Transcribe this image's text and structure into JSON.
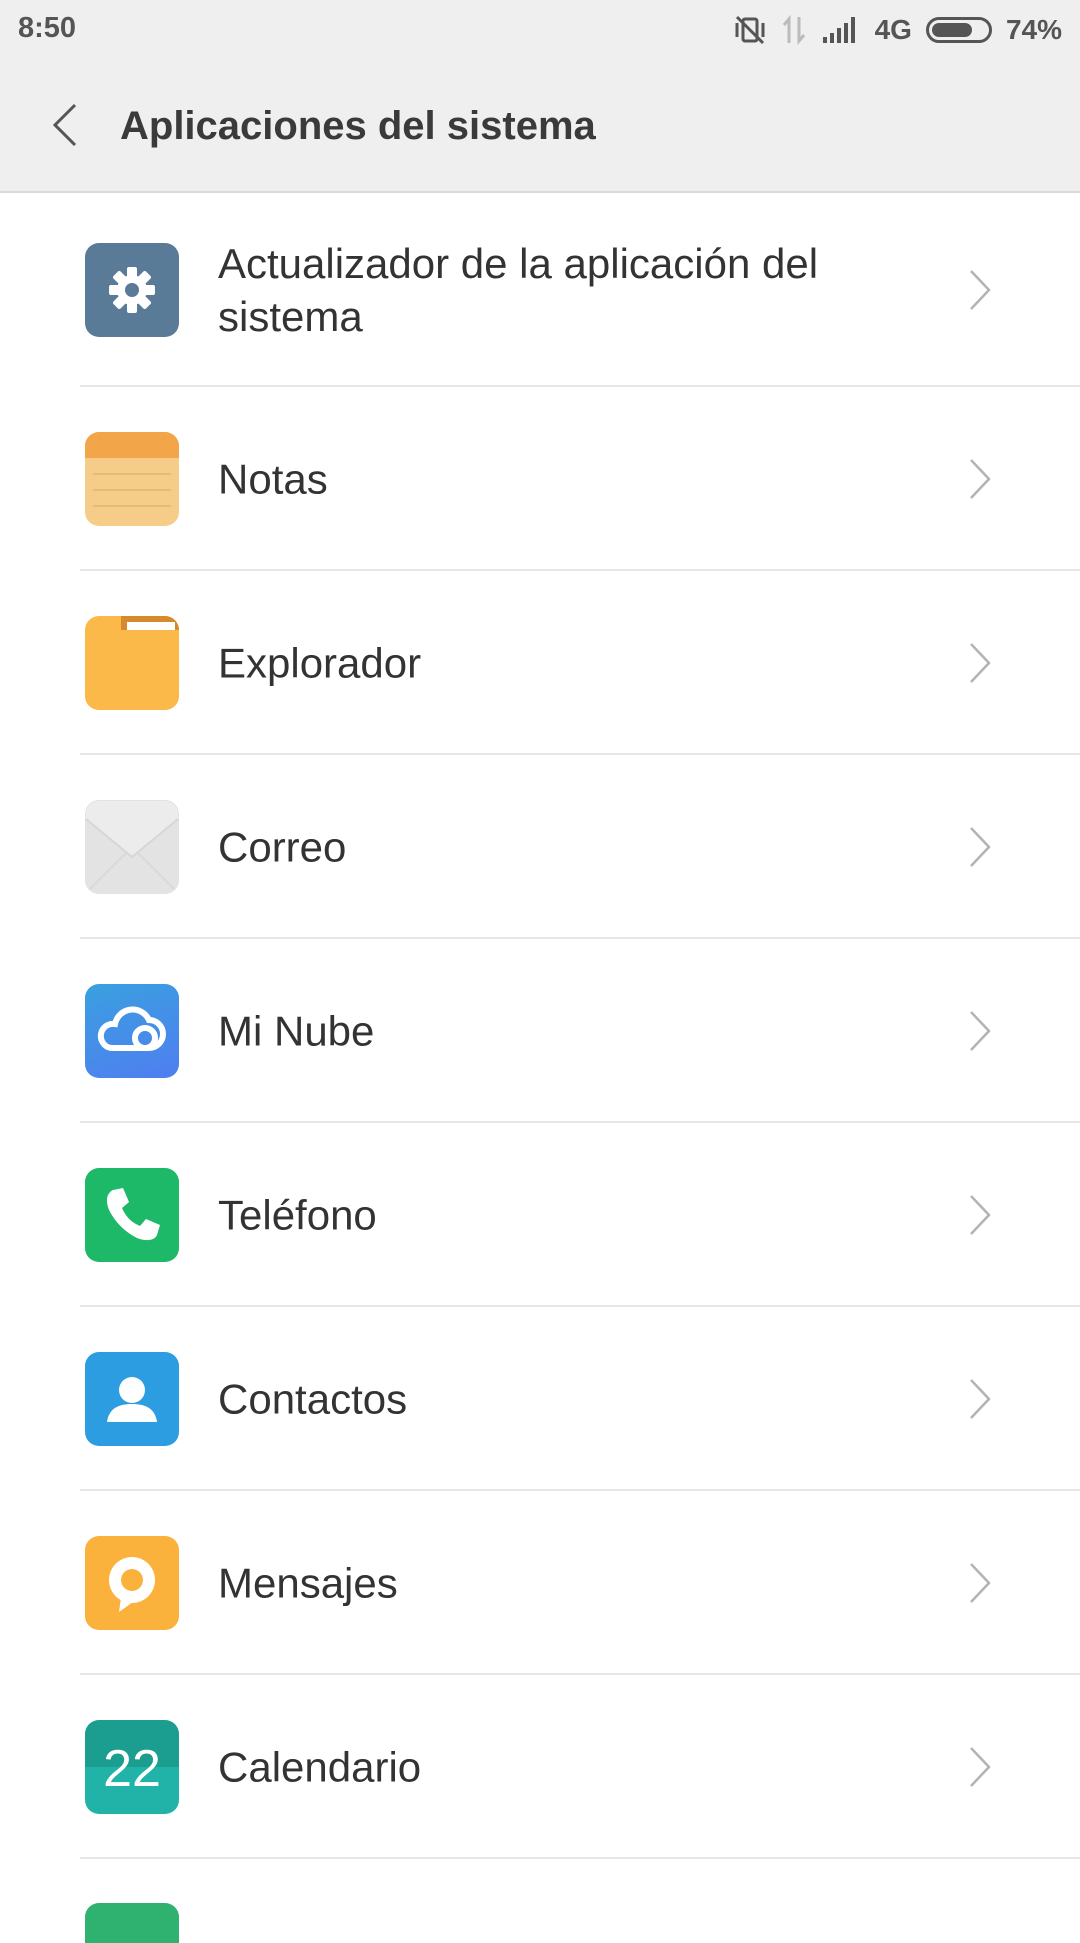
{
  "status_bar": {
    "time": "8:50",
    "network": "4G",
    "battery_percent": "74%",
    "battery_level": 0.74,
    "icons": [
      "vibrate-off-icon",
      "data-arrows-icon",
      "signal-icon",
      "battery-icon"
    ]
  },
  "header": {
    "back_icon": "chevron-left-icon",
    "title": "Aplicaciones del sistema"
  },
  "apps": [
    {
      "label": "Actualizador de la aplicación del sistema",
      "icon": "gear-icon",
      "color": "#5a7b97"
    },
    {
      "label": "Notas",
      "icon": "notes-icon",
      "color": "#f5cd88"
    },
    {
      "label": "Explorador",
      "icon": "folder-icon",
      "color": "#fbb94a"
    },
    {
      "label": "Correo",
      "icon": "envelope-icon",
      "color": "#eeeeee"
    },
    {
      "label": "Mi Nube",
      "icon": "cloud-icon",
      "color": "#4a8be6"
    },
    {
      "label": "Teléfono",
      "icon": "phone-icon",
      "color": "#1db868"
    },
    {
      "label": "Contactos",
      "icon": "contact-icon",
      "color": "#2b9de0"
    },
    {
      "label": "Mensajes",
      "icon": "message-icon",
      "color": "#fbb23d"
    },
    {
      "label": "Calendario",
      "icon": "calendar-icon",
      "color": "#1da99f",
      "calendar_day": "22"
    }
  ]
}
